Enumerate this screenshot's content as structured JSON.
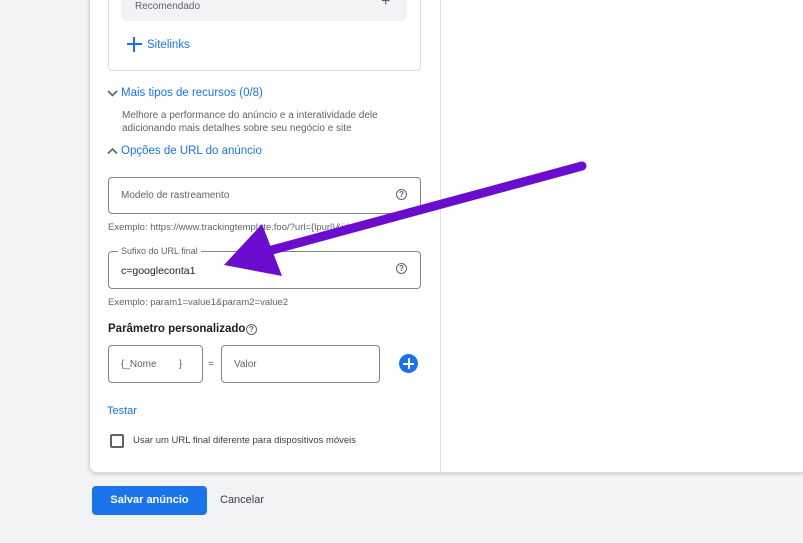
{
  "sitelinks_card": {
    "recommended_label": "Recomendado",
    "add_sitelinks_label": "Sitelinks"
  },
  "more_resources": {
    "label": "Mais tipos de recursos (0/8)",
    "description": "Melhore a performance do anúncio e a interatividade dele adicionando mais detalhes sobre seu negócio e site"
  },
  "url_options": {
    "label": "Opções de URL do anúncio",
    "tracking_template": {
      "placeholder": "Modelo de rastreamento",
      "hint": "Exemplo: https://www.trackingtemplate.foo/?url={lpurl}&id=5"
    },
    "final_url_suffix": {
      "label": "Sufixo do URL final",
      "value": "c=googleconta1",
      "hint": "Exemplo: param1=value1&param2=value2"
    },
    "custom_param": {
      "title": "Parâmetro personalizado",
      "name_placeholder": "{_Nome        }",
      "equals": "=",
      "value_placeholder": "Valor"
    },
    "test_label": "Testar",
    "mobile_url_checkbox": {
      "label": "Usar um URL final diferente para dispositivos móveis",
      "checked": false
    }
  },
  "footer": {
    "save_label": "Salvar anúncio",
    "cancel_label": "Cancelar"
  },
  "colors": {
    "accent": "#1a73e8",
    "annotation_arrow": "#6a0dce"
  },
  "icons": [
    "plus-icon",
    "chevron-down-icon",
    "chevron-up-icon",
    "help-icon",
    "add-circle-icon",
    "checkbox-icon",
    "arrow-annotation"
  ]
}
